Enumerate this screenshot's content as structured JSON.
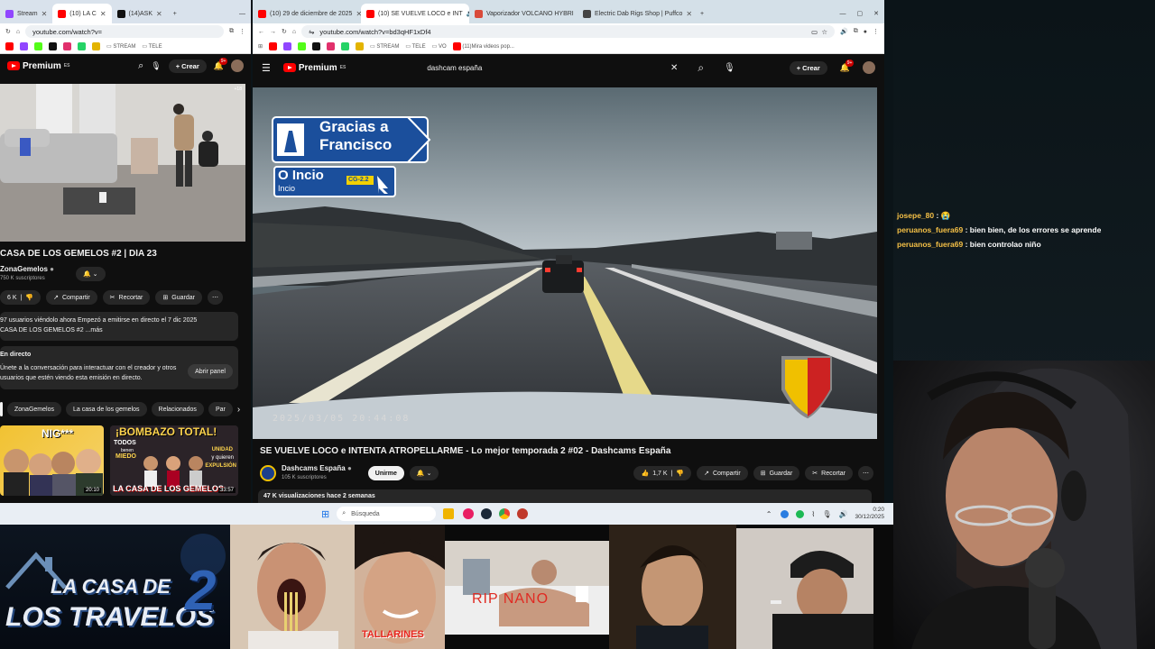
{
  "left_browser": {
    "tabs": [
      {
        "label": "Stream",
        "color": "#9146ff"
      },
      {
        "label": "(10) LA C",
        "color": "#ff0000"
      },
      {
        "label": "(14)ASK",
        "color": "#111111"
      }
    ],
    "url": "youtube.com/watch?v=",
    "bookmarks": [
      "STREAM",
      "TELE"
    ],
    "header": {
      "logo": "Premium",
      "logo_sup": "ES",
      "create_label": "Crear",
      "notif_badge": "9+"
    },
    "live_badge": "+18",
    "video_title": "CASA DE LOS GEMELOS #2 | DÍA 23",
    "channel": {
      "name": "ZonaGemelos",
      "subs": "750 K suscriptores"
    },
    "actions": {
      "likes": "6 K",
      "share": "Compartir",
      "clip": "Recortar",
      "save": "Guardar"
    },
    "description": {
      "line1": "97 usuarios viéndolo ahora  Empezó a emitirse en directo el 7 dic 2025",
      "line2": "CASA DE LOS GEMELOS #2 ...más"
    },
    "chat_box": {
      "title": "En directo",
      "text1": "Únete a la conversación para interactuar con el creador y otros",
      "text2": "usuarios que estén viendo esta emisión en directo.",
      "button": "Abrir panel"
    },
    "chips": [
      "ZonaGemelos",
      "La casa de los gemelos",
      "Relacionados",
      "Par"
    ],
    "thumbs": [
      {
        "text": "NIG***",
        "duration": "20:10"
      },
      {
        "text": "¡BOMBAZO TOTAL!",
        "sub1": "TODOS",
        "sub2": "benen",
        "sub3": "MIEDO",
        "sub4": "y quieren",
        "sub5": "UNIDAD",
        "sub6": "EXPULSIÓN",
        "bottom": "LA CASA DE LOS GEMELOS",
        "duration": "33:57"
      }
    ]
  },
  "right_browser": {
    "tabs": [
      {
        "label": "(10) 29 de diciembre de 2025",
        "color": "#ff0000"
      },
      {
        "label": "(10) SE VUELVE LOCO e INT",
        "color": "#ff0000"
      },
      {
        "label": "Vaporizador VOLCANO HYBRI",
        "color": "#d94a3a"
      },
      {
        "label": "Electric Dab Rigs Shop | Puffco",
        "color": "#444444"
      }
    ],
    "url": "youtube.com/watch?v=bd3qHF1xDf4",
    "bookmarks": [
      "STREAM",
      "TELE",
      "VO",
      "(11)Mira videos pop..."
    ],
    "header": {
      "logo": "Premium",
      "logo_sup": "ES",
      "search_value": "dashcam españa",
      "create_label": "Crear",
      "notif_badge": "9+"
    },
    "sign": {
      "line1": "Gracias a",
      "line2": "Francisco",
      "exit_name": "O Incio",
      "exit_sub": "Incio",
      "road": "CG-2.2"
    },
    "timestamp": "2025/03/05  20:44:08",
    "video_title": "SE VUELVE LOCO e INTENTA ATROPELLARME - Lo mejor temporada 2 #02 - Dashcams España",
    "channel": {
      "name": "Dashcams España",
      "subs": "105 K suscriptores",
      "join": "Unirme"
    },
    "actions": {
      "likes": "1,7 K",
      "share": "Compartir",
      "save": "Guardar",
      "clip": "Recortar"
    },
    "meta": "47 K visualizaciones  hace 2 semanas"
  },
  "taskbar": {
    "search": "Búsqueda",
    "time": "0:20",
    "date": "30/12/2025"
  },
  "overlay": {
    "logo_line1": "LA CASA DE",
    "logo_line2": "LOS TRAVELOS",
    "logo_num": "2",
    "caption_tallarines": "TALLARINES",
    "caption_rip": "RIP NANO"
  },
  "chat": [
    {
      "user": "josepe_80",
      "text": ""
    },
    {
      "user": "peruanos_fuera69",
      "text": "bien bien, de los errores se aprende"
    },
    {
      "user": "peruanos_fuera69",
      "text": "bien controlao niño"
    }
  ]
}
